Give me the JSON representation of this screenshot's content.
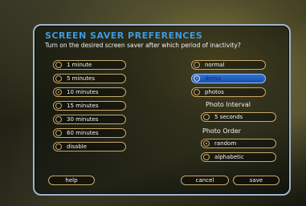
{
  "header": {
    "title": "SCREEN SAVER PREFERENCES",
    "subtitle": "Turn on the desired screen saver after which period of inactivity?"
  },
  "timeouts": [
    {
      "label": "1 minute",
      "selected": false
    },
    {
      "label": "5 minutes",
      "selected": false
    },
    {
      "label": "10 minutes",
      "selected": true
    },
    {
      "label": "15 minutes",
      "selected": false
    },
    {
      "label": "30 minutes",
      "selected": false
    },
    {
      "label": "60 minutes",
      "selected": false
    },
    {
      "label": "disable",
      "selected": false
    }
  ],
  "modes": [
    {
      "label": "normal",
      "selected": false
    },
    {
      "label": "demo",
      "selected": true,
      "highlighted": true
    },
    {
      "label": "photos",
      "selected": false
    }
  ],
  "photo_interval": {
    "label": "Photo Interval",
    "value": "5 seconds"
  },
  "photo_order": {
    "label": "Photo Order",
    "options": [
      {
        "label": "random",
        "selected": true
      },
      {
        "label": "alphabetic",
        "selected": false
      }
    ]
  },
  "footer": {
    "help": "help",
    "cancel": "cancel",
    "save": "save"
  },
  "colors": {
    "title": "#3d9be0",
    "button_border": "#c9a96b",
    "highlight": "#2c72d6",
    "panel_border": "#9fb6cf"
  }
}
